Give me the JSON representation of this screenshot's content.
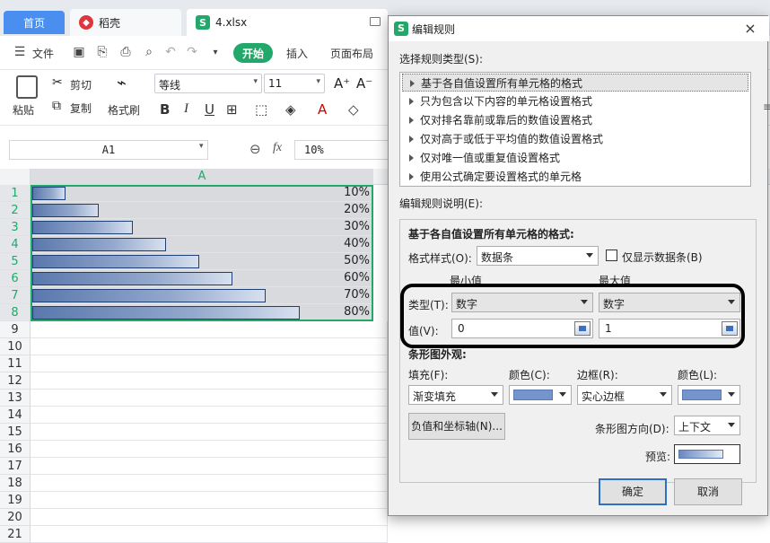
{
  "tabs": {
    "home": "首页",
    "daoke": "稻壳",
    "file": "4.xlsx"
  },
  "menu": {
    "hamburger_label": "文件",
    "start": "开始",
    "insert": "插入",
    "page_layout": "页面布局"
  },
  "ribbon": {
    "paste": "粘贴",
    "cut": "剪切",
    "copy": "复制",
    "format_painter": "格式刷",
    "font_family": "等线",
    "font_size": "11",
    "grow_font": "A⁺",
    "shrink_font": "A⁻"
  },
  "formula_bar": {
    "name_box": "A1",
    "fx": "fx",
    "value": "10%"
  },
  "sheet": {
    "column_header": "A",
    "rows": [
      {
        "row": "1",
        "value": "10%",
        "fraction": 0.1
      },
      {
        "row": "2",
        "value": "20%",
        "fraction": 0.2
      },
      {
        "row": "3",
        "value": "30%",
        "fraction": 0.3
      },
      {
        "row": "4",
        "value": "40%",
        "fraction": 0.4
      },
      {
        "row": "5",
        "value": "50%",
        "fraction": 0.5
      },
      {
        "row": "6",
        "value": "60%",
        "fraction": 0.6
      },
      {
        "row": "7",
        "value": "70%",
        "fraction": 0.7
      },
      {
        "row": "8",
        "value": "80%",
        "fraction": 0.8
      }
    ],
    "empty_rows": [
      "9",
      "10",
      "11",
      "12",
      "13",
      "14",
      "15",
      "16",
      "17",
      "18",
      "19",
      "20",
      "21"
    ]
  },
  "dialog": {
    "title": "编辑规则",
    "close": "×",
    "select_rule_type_label": "选择规则类型(S):",
    "rule_types": [
      "基于各自值设置所有单元格的格式",
      "只为包含以下内容的单元格设置格式",
      "仅对排名靠前或靠后的数值设置格式",
      "仅对高于或低于平均值的数值设置格式",
      "仅对唯一值或重复值设置格式",
      "使用公式确定要设置格式的单元格"
    ],
    "edit_rule_desc_label": "编辑规则说明(E):",
    "desc_heading": "基于各自值设置所有单元格的格式:",
    "format_style_label": "格式样式(O):",
    "format_style_value": "数据条",
    "show_bar_only_label": "仅显示数据条(B)",
    "min_label": "最小值",
    "max_label": "最大值",
    "type_label": "类型(T):",
    "min_type": "数字",
    "max_type": "数字",
    "value_label": "值(V):",
    "min_value": "0",
    "max_value": "1",
    "bar_appearance_label": "条形图外观:",
    "fill_label": "填充(F):",
    "fill_value": "渐变填充",
    "color_label_c": "颜色(C):",
    "border_label": "边框(R):",
    "border_value": "实心边框",
    "color_label_l": "颜色(L):",
    "neg_axis_button": "负值和坐标轴(N)...",
    "bar_direction_label": "条形图方向(D):",
    "bar_direction_value": "上下文",
    "preview_label": "预览:",
    "ok": "确定",
    "cancel": "取消",
    "bar_color": "#7594cc",
    "border_color": "#7594cc"
  }
}
